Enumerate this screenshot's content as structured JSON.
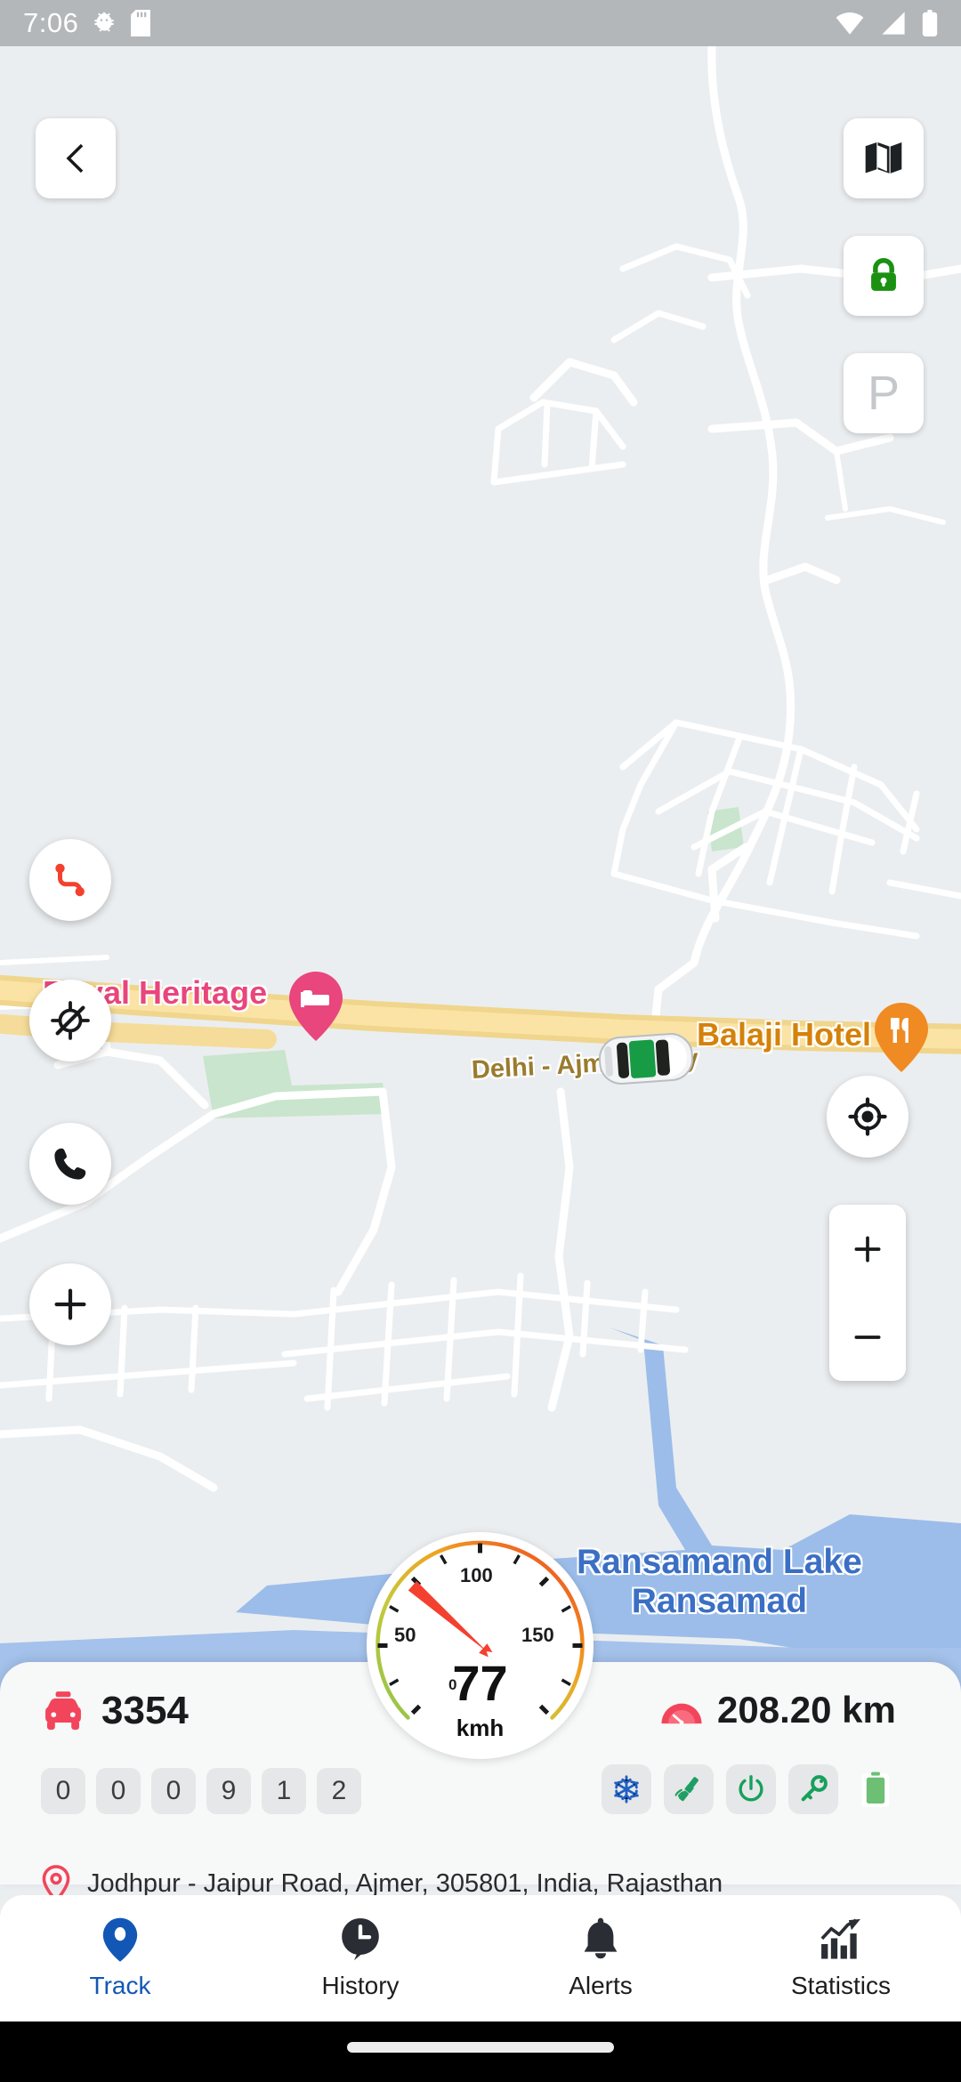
{
  "status_bar": {
    "time": "7:06",
    "icons_left": [
      "android-debug-icon",
      "sd-card-icon"
    ],
    "icons_right": [
      "wifi-icon",
      "cellular-signal-icon",
      "battery-icon"
    ]
  },
  "map": {
    "background_color": "#ebeef0",
    "road_color": "#ffffff",
    "highway_color": "#f7d88f",
    "water_color": "#9cbdea",
    "park_color": "#c9e5cd",
    "labels": {
      "royal_heritage": "Royal Heritage",
      "balaji_hotel": "Balaji Hotel",
      "expressway": "Delhi - Ajmer Expy",
      "lake_line1": "Ransamand Lake",
      "lake_line2": "Ransamad"
    },
    "pois": [
      {
        "name": "Royal Heritage",
        "type": "hotel-pin",
        "color": "#e8467c"
      },
      {
        "name": "Balaji Hotel",
        "type": "restaurant-pin",
        "color": "#ef8b22"
      }
    ],
    "vehicle_marker": {
      "type": "car-top-view",
      "body_color": "#ffffff",
      "roof_color": "#179b45"
    }
  },
  "map_buttons": {
    "back": "back-chevron-icon",
    "map_type": "map-layers-icon",
    "lock": "lock-icon",
    "lock_color": "#1a9112",
    "parking": "P",
    "parking_color": "#c5c8cb"
  },
  "action_buttons": [
    {
      "name": "route-icon",
      "color": "#f4402e"
    },
    {
      "name": "gps-off-icon",
      "color": "#17191b"
    },
    {
      "name": "phone-icon",
      "color": "#17191b"
    },
    {
      "name": "add-icon",
      "color": "#17191b"
    }
  ],
  "map_controls": {
    "my_location": "my-location-icon",
    "zoom_in": "+",
    "zoom_out": "−"
  },
  "speedometer": {
    "value": "77",
    "unit": "kmh",
    "ticks": [
      "0",
      "50",
      "100",
      "150"
    ],
    "min": 0,
    "max": 200,
    "arc_start_color": "#8ec449",
    "arc_mid_color": "#efa321",
    "arc_end_color": "#ef3a22",
    "needle_color": "#f4402e"
  },
  "info_card": {
    "vehicle_icon": "car-icon",
    "vehicle_icon_color": "#f2455c",
    "vehicle_number": "3354",
    "distance_icon": "odometer-gauge-icon",
    "distance_icon_color": "#f2455c",
    "distance": "208.20 km",
    "odometer_digits": [
      "0",
      "0",
      "0",
      "9",
      "1",
      "2"
    ],
    "status_chips": [
      {
        "name": "ac-snowflake-icon",
        "color": "#1f5fc4",
        "active": true
      },
      {
        "name": "gps-satellite-icon",
        "color": "#1f9e63",
        "active": true
      },
      {
        "name": "power-icon",
        "color": "#16a05c",
        "active": true
      },
      {
        "name": "ignition-key-icon",
        "color": "#16a05c",
        "active": true
      },
      {
        "name": "battery-icon",
        "color": "#6cbf73",
        "active": true
      }
    ],
    "address_icon": "location-pin-icon",
    "address_icon_color": "#f2455c",
    "address": "Jodhpur - Jaipur Road, Ajmer, 305801, India, Rajasthan"
  },
  "bottom_nav": {
    "active_color": "#1357b6",
    "inactive_color": "#1d1d1f",
    "items": [
      {
        "label": "Track",
        "icon": "location-pin-icon",
        "active": true
      },
      {
        "label": "History",
        "icon": "clock-icon",
        "active": false
      },
      {
        "label": "Alerts",
        "icon": "bell-icon",
        "active": false
      },
      {
        "label": "Statistics",
        "icon": "bar-chart-icon",
        "active": false
      }
    ]
  }
}
